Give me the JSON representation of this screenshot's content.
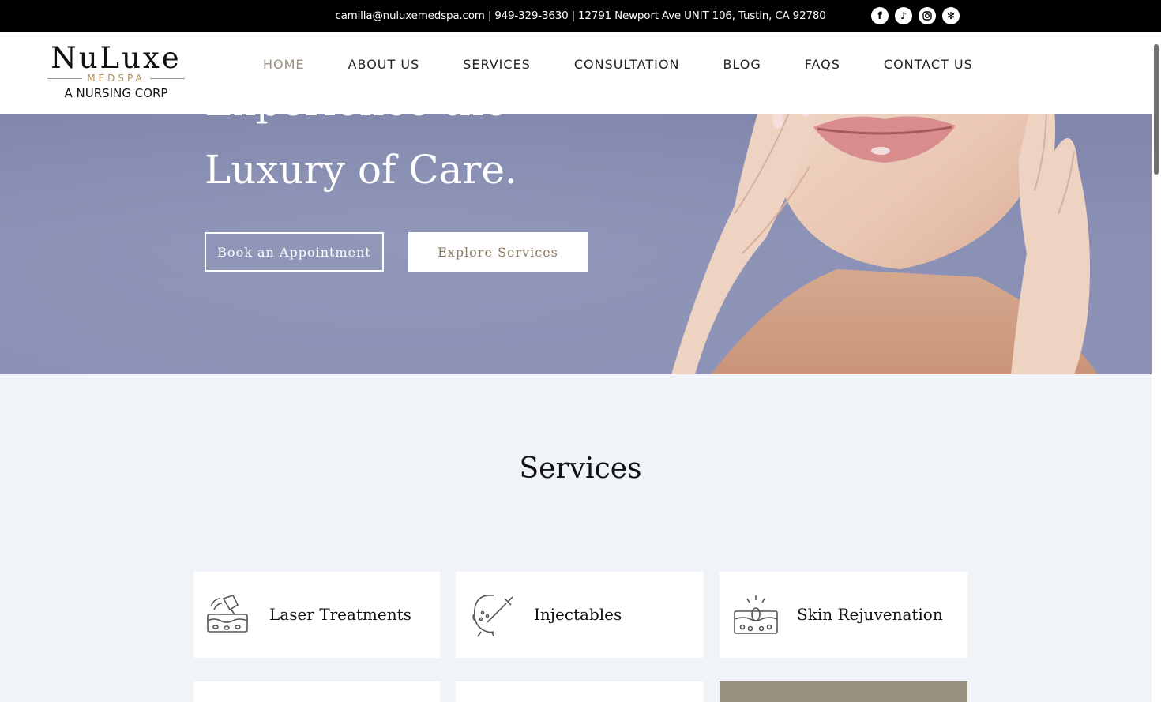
{
  "topbar": {
    "contact": "camilla@nuluxemedspa.com | 949-329-3630 | 12791 Newport Ave UNIT 106, Tustin, CA 92780",
    "socials": [
      "facebook-icon",
      "tiktok-icon",
      "instagram-icon",
      "yelp-icon"
    ]
  },
  "logo": {
    "brand": "NuLuxe",
    "sub": "MEDSPA",
    "corp": "A NURSING CORP"
  },
  "nav": {
    "items": [
      "HOME",
      "ABOUT US",
      "SERVICES",
      "CONSULTATION",
      "BLOG",
      "FAQS",
      "CONTACT US"
    ],
    "active": "HOME"
  },
  "hero": {
    "line1": "Experience the",
    "line2": "Luxury of Care.",
    "book_label": "Book an Appointment",
    "explore_label": "Explore Services"
  },
  "services": {
    "title": "Services",
    "cards": [
      "Laser Treatments",
      "Injectables",
      "Skin Rejuvenation"
    ]
  },
  "colors": {
    "accent": "#9a8f7d",
    "hero_bg": "#8a90b4",
    "page_bg": "#f0f4f8",
    "card_tan": "#9a907f"
  }
}
